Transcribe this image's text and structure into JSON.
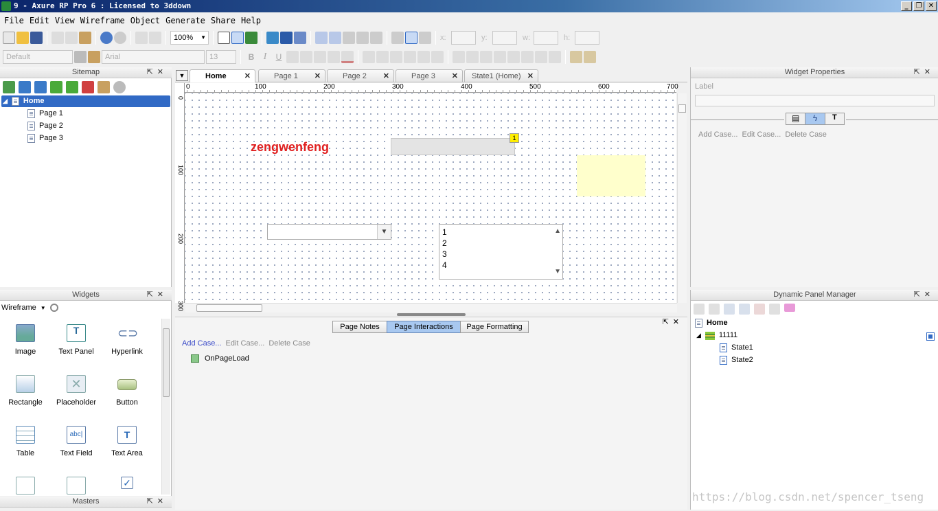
{
  "window": {
    "title": "9 - Axure RP Pro 6 : Licensed to 3ddown"
  },
  "menu": [
    "File",
    "Edit",
    "View",
    "Wireframe",
    "Object",
    "Generate",
    "Share",
    "Help"
  ],
  "toolbar": {
    "zoom": "100%",
    "style_default": "Default",
    "font": "Arial",
    "font_size": "13",
    "bold": "B",
    "italic": "I",
    "underline": "U",
    "x_label": "x:",
    "y_label": "y:",
    "w_label": "w:",
    "h_label": "h:"
  },
  "sitemap": {
    "title": "Sitemap",
    "root": "Home",
    "pages": [
      "Page 1",
      "Page 2",
      "Page 3"
    ]
  },
  "widgets": {
    "title": "Widgets",
    "library": "Wireframe",
    "items": [
      "Image",
      "Text Panel",
      "Hyperlink",
      "Rectangle",
      "Placeholder",
      "Button",
      "Table",
      "Text Field",
      "Text Area"
    ]
  },
  "masters": {
    "title": "Masters"
  },
  "tabs": [
    "Home",
    "Page 1",
    "Page 2",
    "Page 3",
    "State1 (Home)"
  ],
  "ruler": {
    "h_ticks": [
      "0",
      "100",
      "200",
      "300",
      "400",
      "500",
      "600",
      "700"
    ],
    "v_ticks": [
      "0",
      "100",
      "200",
      "300"
    ]
  },
  "canvas": {
    "heading_text": "zengwenfeng",
    "badge": "1",
    "listbox_items": [
      "1",
      "2",
      "3",
      "4"
    ]
  },
  "bottom_tabs": [
    "Page Notes",
    "Page Interactions",
    "Page Formatting"
  ],
  "page_interactions": {
    "add": "Add Case...",
    "edit": "Edit Case...",
    "delete": "Delete Case",
    "event": "OnPageLoad"
  },
  "widget_properties": {
    "title": "Widget Properties",
    "label": "Label",
    "add": "Add Case...",
    "edit": "Edit Case...",
    "delete": "Delete Case"
  },
  "dpm": {
    "title": "Dynamic Panel Manager",
    "page": "Home",
    "panel": "11111",
    "states": [
      "State1",
      "State2"
    ]
  },
  "watermark": "https://blog.csdn.net/spencer_tseng",
  "colors": {
    "accent": "#316ac5",
    "heading_red": "#e02020",
    "note_yellow": "#ffffcc"
  }
}
